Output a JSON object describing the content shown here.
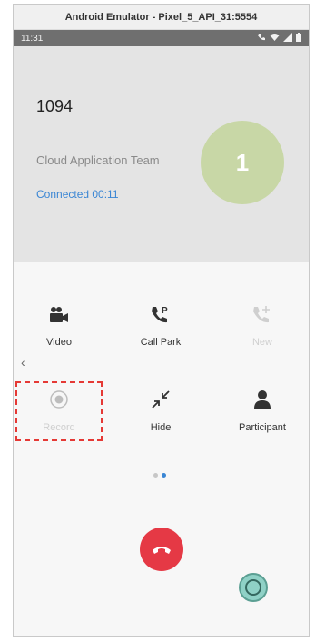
{
  "window": {
    "title": "Android Emulator - Pixel_5_API_31:5554"
  },
  "status_bar": {
    "time": "11:31",
    "icons": [
      "phone-icon",
      "wifi-icon",
      "signal-icon",
      "battery-icon"
    ]
  },
  "call": {
    "number": "1094",
    "organization": "Cloud Application Team",
    "status": "Connected 00:11",
    "avatar_text": "1"
  },
  "actions": {
    "video": "Video",
    "call_park": "Call Park",
    "new_call": "New",
    "record": "Record",
    "hide": "Hide",
    "participant": "Participant"
  },
  "pager": {
    "pages": 2,
    "active": 2
  },
  "colors": {
    "accent": "#3a86d4",
    "end_call": "#e53945",
    "avatar": "#c8d7a6",
    "highlight": "#e53935"
  }
}
